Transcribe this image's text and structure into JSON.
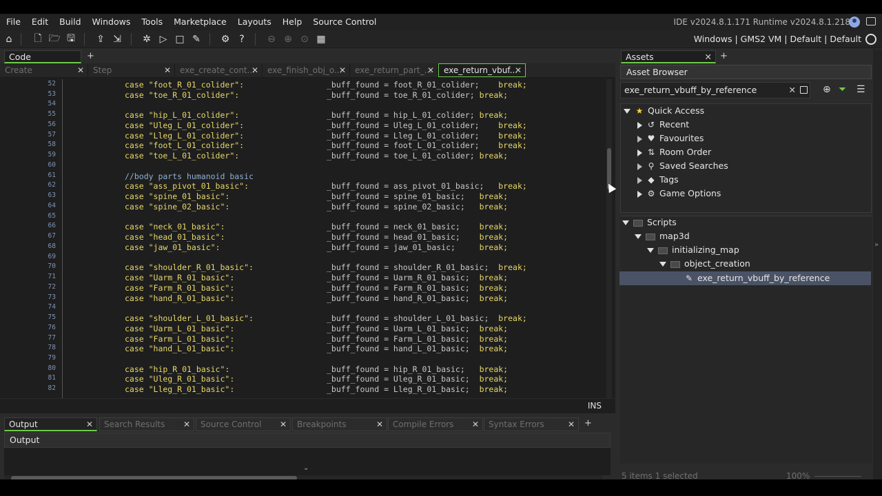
{
  "menu": [
    "File",
    "Edit",
    "Build",
    "Windows",
    "Tools",
    "Marketplace",
    "Layouts",
    "Help",
    "Source Control"
  ],
  "version": "IDE v2024.8.1.171  Runtime v2024.8.1.218",
  "target": "Windows | GMS2 VM | Default | Default",
  "code_tab": "Code",
  "file_tabs": [
    "Create",
    "Step",
    "exe_create_cont...",
    "exe_finish_obj_o...",
    "exe_return_part_...",
    "exe_return_vbuf..."
  ],
  "code_lines": [
    {
      "n": "52",
      "t": "kw",
      "c": "case \"foot_R_01_colider\":",
      "v": "_buff_found = foot_R_01_colider;    break;"
    },
    {
      "n": "53",
      "t": "kw",
      "c": "case \"toe_R_01_colider\":",
      "v": "_buff_found = toe_R_01_colider; break;"
    },
    {
      "n": "54",
      "t": "blank",
      "c": "",
      "v": ""
    },
    {
      "n": "55",
      "t": "kw",
      "c": "case \"hip_L_01_colider\":",
      "v": "_buff_found = hip_L_01_colider; break;"
    },
    {
      "n": "56",
      "t": "kw",
      "c": "case \"Uleg_L_01_colider\":",
      "v": "_buff_found = Uleg_L_01_colider;    break;"
    },
    {
      "n": "57",
      "t": "kw",
      "c": "case \"Lleg_L_01_colider\":",
      "v": "_buff_found = Lleg_L_01_colider;    break;"
    },
    {
      "n": "58",
      "t": "kw",
      "c": "case \"foot_L_01_colider\":",
      "v": "_buff_found = foot_L_01_colider;    break;"
    },
    {
      "n": "59",
      "t": "kw",
      "c": "case \"toe_L_01_colider\":",
      "v": "_buff_found = toe_L_01_colider; break;"
    },
    {
      "n": "60",
      "t": "blank",
      "c": "",
      "v": ""
    },
    {
      "n": "61",
      "t": "comment",
      "c": "//body parts humanoid basic",
      "v": ""
    },
    {
      "n": "62",
      "t": "kw",
      "c": "case \"ass_pivot_01_basic\":",
      "v": "_buff_found = ass_pivot_01_basic;   break;"
    },
    {
      "n": "63",
      "t": "kw",
      "c": "case \"spine_01_basic\":",
      "v": "_buff_found = spine_01_basic;   break;"
    },
    {
      "n": "64",
      "t": "kw",
      "c": "case \"spine_02_basic\":",
      "v": "_buff_found = spine_02_basic;   break;"
    },
    {
      "n": "65",
      "t": "blank",
      "c": "",
      "v": ""
    },
    {
      "n": "66",
      "t": "kw",
      "c": "case \"neck_01_basic\":",
      "v": "_buff_found = neck_01_basic;    break;"
    },
    {
      "n": "67",
      "t": "kw",
      "c": "case \"head_01_basic\":",
      "v": "_buff_found = head_01_basic;    break;"
    },
    {
      "n": "68",
      "t": "kw",
      "c": "case \"jaw_01_basic\":",
      "v": "_buff_found = jaw_01_basic;     break;"
    },
    {
      "n": "69",
      "t": "blank",
      "c": "",
      "v": ""
    },
    {
      "n": "70",
      "t": "kw",
      "c": "case \"shoulder_R_01_basic\":",
      "v": "_buff_found = shoulder_R_01_basic;  break;"
    },
    {
      "n": "71",
      "t": "kw",
      "c": "case \"Uarm_R_01_basic\":",
      "v": "_buff_found = Uarm_R_01_basic;  break;"
    },
    {
      "n": "72",
      "t": "kw",
      "c": "case \"Farm_R_01_basic\":",
      "v": "_buff_found = Farm_R_01_basic;  break;"
    },
    {
      "n": "73",
      "t": "kw",
      "c": "case \"hand_R_01_basic\":",
      "v": "_buff_found = hand_R_01_basic;  break;"
    },
    {
      "n": "74",
      "t": "blank",
      "c": "",
      "v": ""
    },
    {
      "n": "75",
      "t": "kw",
      "c": "case \"shoulder_L_01_basic\":",
      "v": "_buff_found = shoulder_L_01_basic;  break;"
    },
    {
      "n": "76",
      "t": "kw",
      "c": "case \"Uarm_L_01_basic\":",
      "v": "_buff_found = Uarm_L_01_basic;  break;"
    },
    {
      "n": "77",
      "t": "kw",
      "c": "case \"Farm_L_01_basic\":",
      "v": "_buff_found = Farm_L_01_basic;  break;"
    },
    {
      "n": "78",
      "t": "kw",
      "c": "case \"hand_L_01_basic\":",
      "v": "_buff_found = hand_L_01_basic;  break;"
    },
    {
      "n": "79",
      "t": "blank",
      "c": "",
      "v": ""
    },
    {
      "n": "80",
      "t": "kw",
      "c": "case \"hip_R_01_basic\":",
      "v": "_buff_found = hip_R_01_basic;   break;"
    },
    {
      "n": "81",
      "t": "kw",
      "c": "case \"Uleg_R_01_basic\":",
      "v": "_buff_found = Uleg_R_01_basic;  break;"
    },
    {
      "n": "82",
      "t": "kw",
      "c": "case \"Lleg_R_01_basic\":",
      "v": "_buff_found = Lleg_R_01_basic;  break;"
    }
  ],
  "ins": "INS",
  "output_tabs": [
    "Output",
    "Search Results",
    "Source Control",
    "Breakpoints",
    "Compile Errors",
    "Syntax Errors"
  ],
  "output_title": "Output",
  "assets": {
    "tab": "Assets",
    "header": "Asset Browser",
    "search_value": "exe_return_vbuff_by_reference",
    "quick_access": "Quick Access",
    "qa_items": [
      "Recent",
      "Favourites",
      "Room Order",
      "Saved Searches",
      "Tags",
      "Game Options"
    ],
    "tree": [
      "Scripts",
      "map3d",
      "initializing_map",
      "object_creation",
      "exe_return_vbuff_by_reference"
    ],
    "status": "5 items   1 selected",
    "zoom": "100%"
  }
}
